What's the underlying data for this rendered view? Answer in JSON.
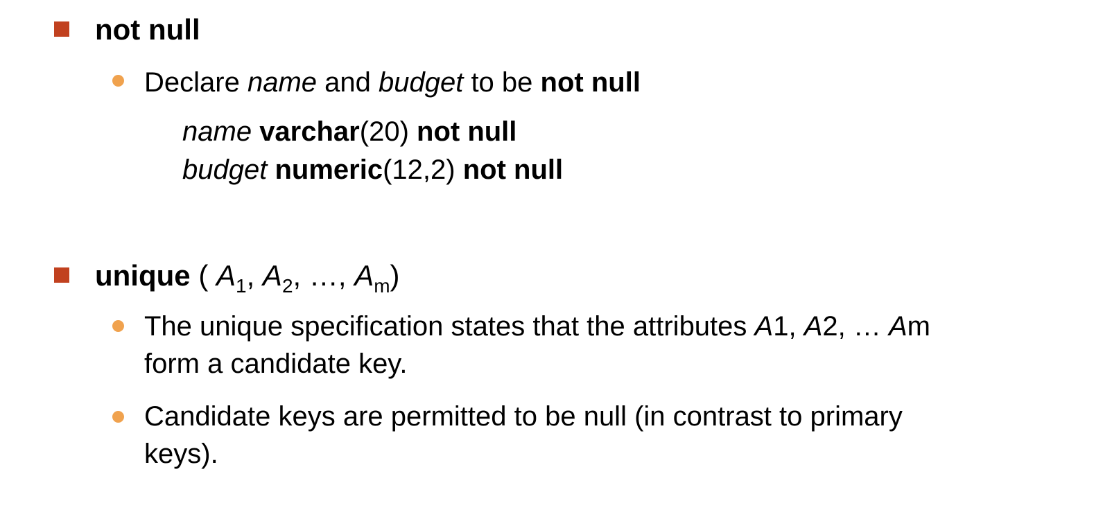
{
  "colors": {
    "square_bullet": "#c1411f",
    "round_bullet": "#f0a24e"
  },
  "section1": {
    "heading": "not null",
    "bullet": {
      "pre": "Declare ",
      "name": "name",
      "and": " and ",
      "budget": "budget",
      "mid": " to be ",
      "bold": "not null"
    },
    "code": [
      {
        "attr": "name",
        "type": "varchar",
        "args": "(20)",
        "constraint": "not null"
      },
      {
        "attr": "budget",
        "type": "numeric",
        "args": "(12,2)",
        "constraint": "not null"
      }
    ]
  },
  "section2": {
    "heading": "unique",
    "open": " ( ",
    "a": "A",
    "sub1": "1",
    "sep1": ", ",
    "sub2": "2",
    "sep2": ", …, ",
    "subm": "m",
    "close": ")",
    "bullets": [
      {
        "line1_pre": "The unique specification states that the attributes ",
        "a1": "A",
        "n1": "1, ",
        "a2": "A",
        "n2": "2, … ",
        "am": "A",
        "nm": "m",
        "line2": "form a candidate key."
      },
      {
        "line1": "Candidate keys are permitted to be null (in contrast to primary",
        "line2": "keys)."
      }
    ]
  }
}
